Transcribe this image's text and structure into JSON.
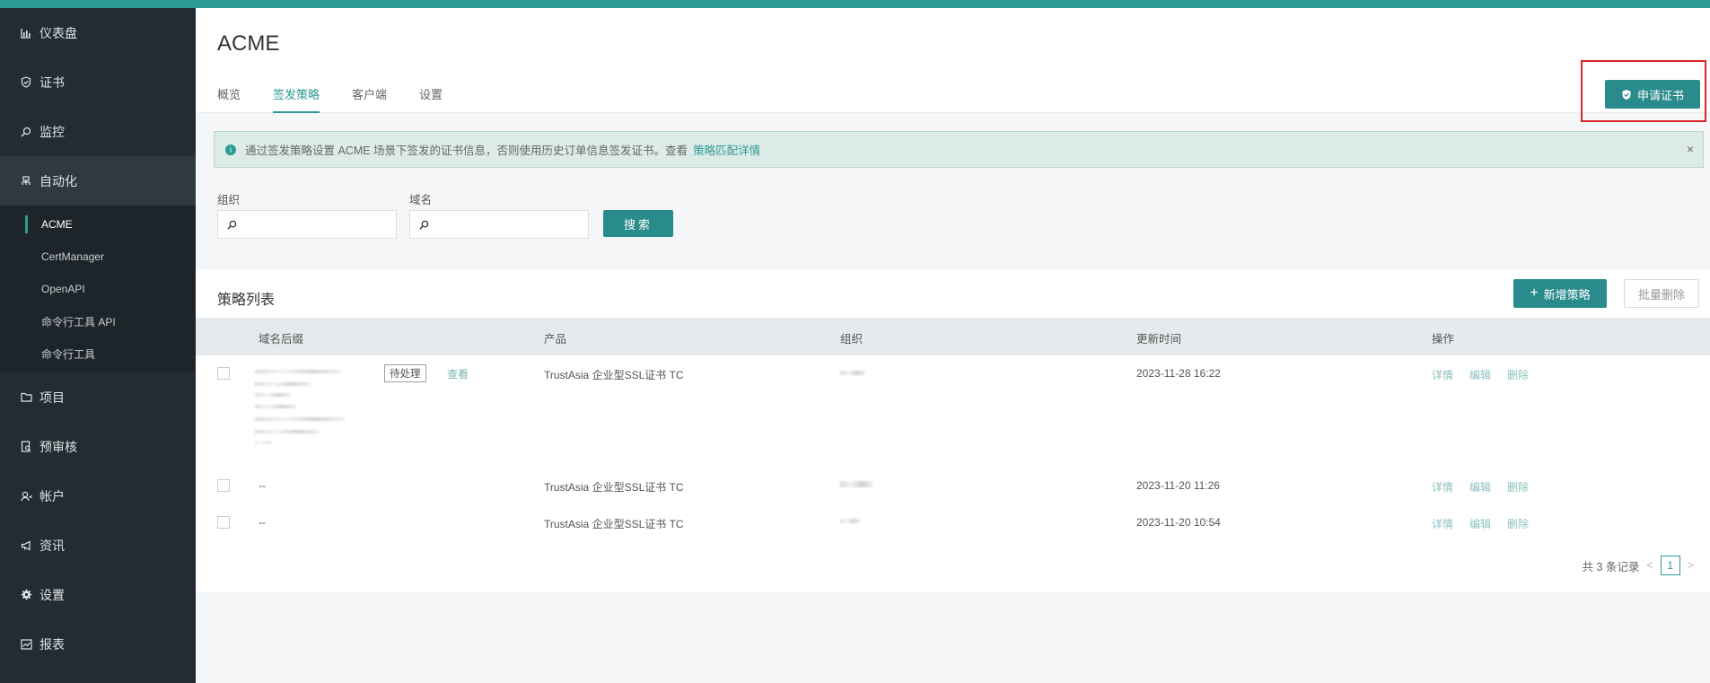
{
  "sidebar": {
    "items": [
      {
        "label": "仪表盘",
        "icon": "chart-bar-icon"
      },
      {
        "label": "证书",
        "icon": "shield-check-icon"
      },
      {
        "label": "监控",
        "icon": "search-icon"
      },
      {
        "label": "自动化",
        "icon": "automation-icon"
      },
      {
        "label": "项目",
        "icon": "folder-icon"
      },
      {
        "label": "预审核",
        "icon": "review-icon"
      },
      {
        "label": "帐户",
        "icon": "account-icon"
      },
      {
        "label": "资讯",
        "icon": "megaphone-icon"
      },
      {
        "label": "设置",
        "icon": "gear-icon"
      },
      {
        "label": "报表",
        "icon": "report-icon"
      }
    ],
    "sub_items": [
      "ACME",
      "CertManager",
      "OpenAPI",
      "命令行工具 API",
      "命令行工具"
    ]
  },
  "header": {
    "title": "ACME",
    "tabs": [
      "概览",
      "签发策略",
      "客户端",
      "设置"
    ],
    "apply_label": "申请证书"
  },
  "alert": {
    "text": "通过签发策略设置 ACME 场景下签发的证书信息，否则使用历史订单信息签发证书。查看",
    "link": "策略匹配详情",
    "close": "×"
  },
  "filters": {
    "org_label": "组织",
    "domain_label": "域名",
    "search_label": "搜索"
  },
  "list": {
    "title": "策略列表",
    "add_label": "新增策略",
    "batch_delete_label": "批量删除",
    "columns": [
      "域名后缀",
      "产品",
      "组织",
      "更新时间",
      "操作"
    ],
    "rows": [
      {
        "domain": "",
        "status": "待处理",
        "view": "查看",
        "product": "TrustAsia 企业型SSL证书 TC",
        "org": "",
        "updated": "2023-11-28 16:22"
      },
      {
        "domain": "--",
        "status": "",
        "view": "",
        "product": "TrustAsia 企业型SSL证书 TC",
        "org": "",
        "updated": "2023-11-20 11:26"
      },
      {
        "domain": "--",
        "status": "",
        "view": "",
        "product": "TrustAsia 企业型SSL证书 TC",
        "org": "",
        "updated": "2023-11-20 10:54"
      }
    ],
    "actions": {
      "detail": "详情",
      "edit": "编辑",
      "delete": "删除"
    }
  },
  "pagination": {
    "total": "共 3 条记录",
    "current": "1",
    "prev": "<",
    "next": ">"
  },
  "colors": {
    "accent": "#2d9a94",
    "button": "#2a8b8c",
    "sidebar_bg": "#232c33",
    "highlight_border": "#d9262c"
  }
}
